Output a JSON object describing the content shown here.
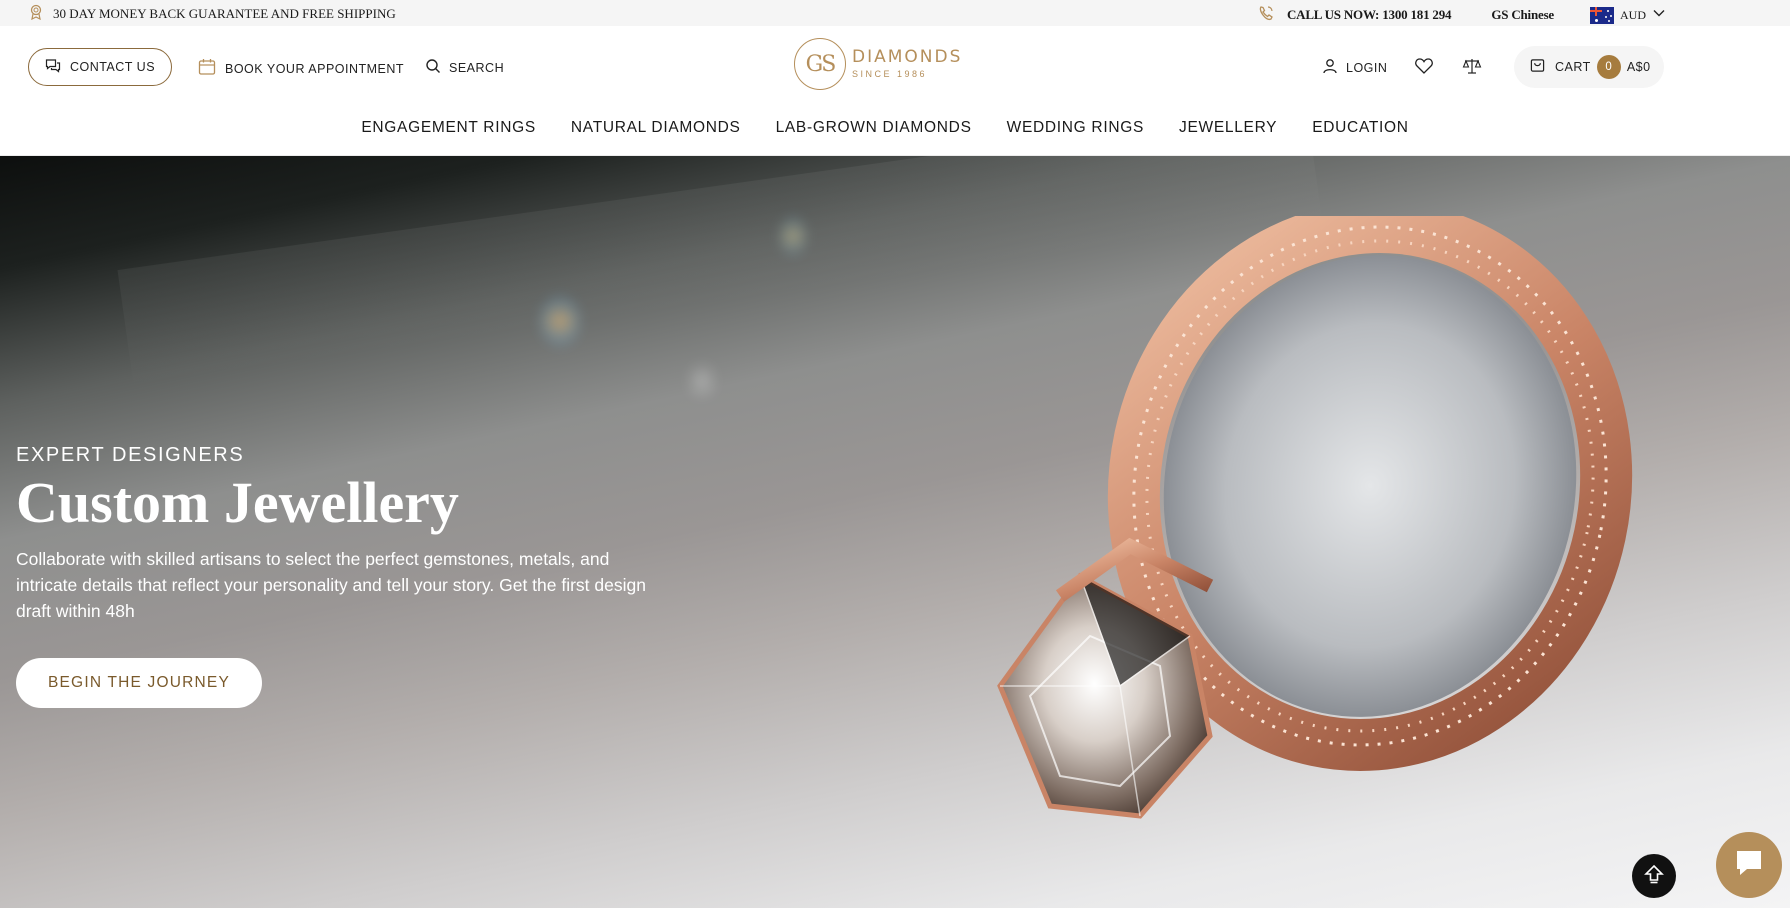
{
  "topbar": {
    "promo_text": "30 DAY MONEY BACK GUARANTEE AND FREE SHIPPING",
    "call_text": "CALL US NOW: 1300 181 294",
    "language_link": "GS Chinese",
    "currency": "AUD"
  },
  "header": {
    "contact_label": "CONTACT US",
    "appointment_label": "BOOK YOUR APPOINTMENT",
    "search_label": "SEARCH",
    "logo": {
      "mark": "GS",
      "name": "DIAMONDS",
      "since": "SINCE 1986"
    },
    "login_label": "LOGIN",
    "cart": {
      "label": "CART",
      "count": "0",
      "total": "A$0"
    }
  },
  "nav": {
    "items": [
      {
        "label": "ENGAGEMENT RINGS"
      },
      {
        "label": "NATURAL DIAMONDS"
      },
      {
        "label": "LAB-GROWN DIAMONDS"
      },
      {
        "label": "WEDDING RINGS"
      },
      {
        "label": "JEWELLERY"
      },
      {
        "label": "EDUCATION"
      }
    ]
  },
  "hero": {
    "eyebrow": "EXPERT DESIGNERS",
    "title": "Custom Jewellery",
    "description": "Collaborate with skilled artisans to select the perfect gemstones, metals, and intricate details that reflect your personality and tell your story. Get the first design draft within 48h",
    "cta_label": "BEGIN THE JOURNEY"
  },
  "colors": {
    "brand_gold": "#b58f5b",
    "cart_badge": "#a67c3e",
    "cta_text": "#7a5a2c"
  },
  "icons": {
    "promo": "badge-icon",
    "call": "phone-icon",
    "flag": "australia-flag-icon",
    "contact": "chat-bubbles-icon",
    "appointment": "calendar-icon",
    "search": "search-icon",
    "login": "user-icon",
    "wishlist": "heart-icon",
    "compare": "scales-icon",
    "cart": "bag-icon",
    "scroll_top": "arrow-up-icon",
    "chat": "chat-icon"
  }
}
